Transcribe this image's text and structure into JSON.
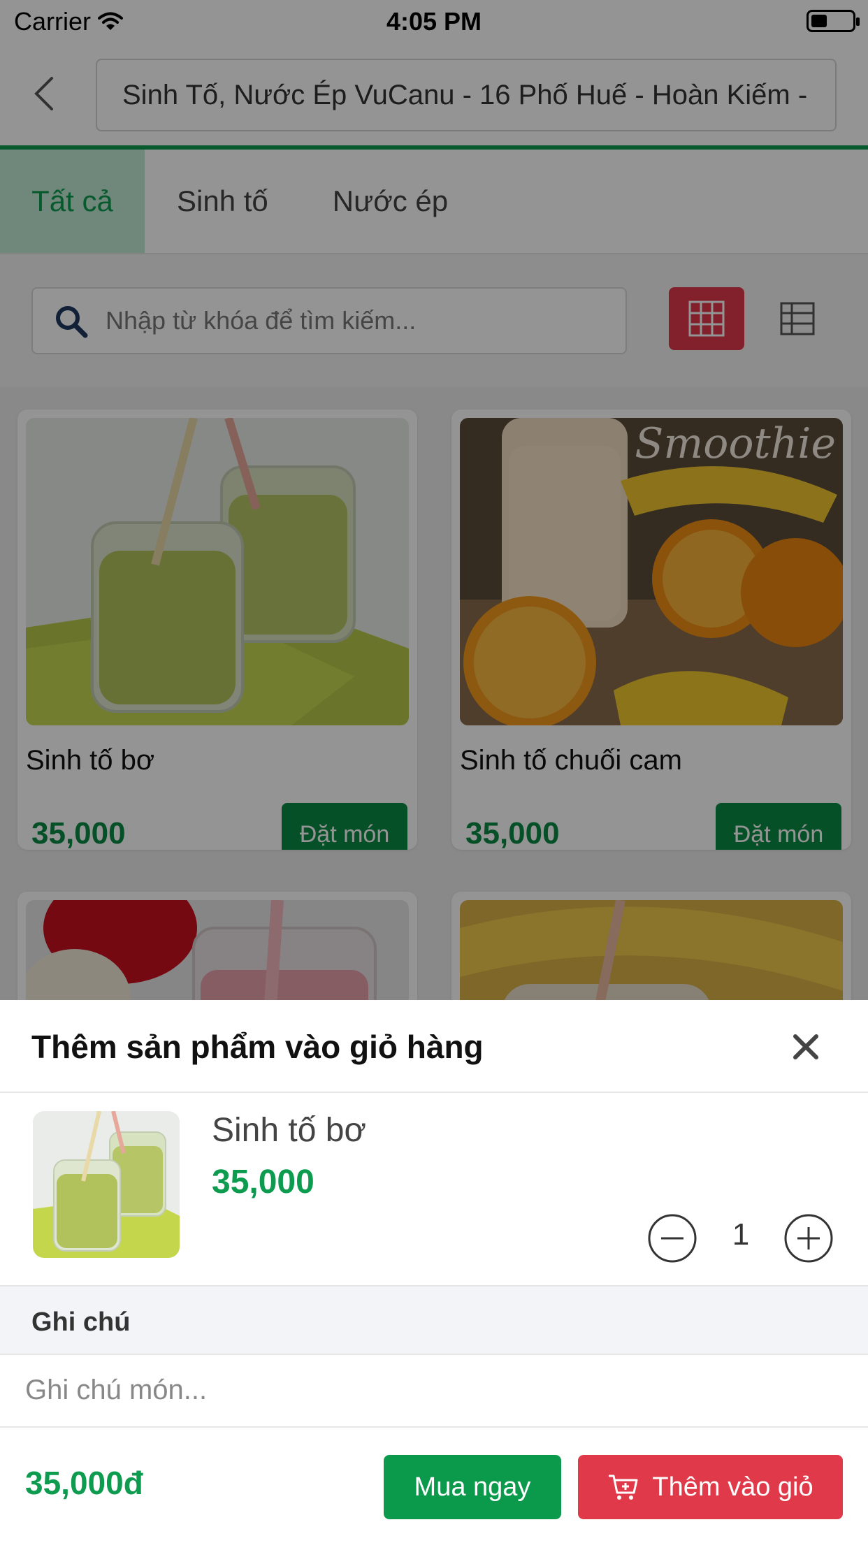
{
  "status_bar": {
    "carrier": "Carrier",
    "time": "4:05 PM"
  },
  "header": {
    "address": "Sinh Tố, Nước Ép VuCanu - 16 Phố Huế - Hoàn Kiếm -"
  },
  "tabs": [
    {
      "label": "Tất cả",
      "active": true
    },
    {
      "label": "Sinh tố",
      "active": false
    },
    {
      "label": "Nước ép",
      "active": false
    }
  ],
  "search": {
    "placeholder": "Nhập từ khóa để tìm kiếm...",
    "value": ""
  },
  "view_toggle": {
    "grid_icon": "grid-icon",
    "list_icon": "list-icon",
    "active": "grid"
  },
  "products": [
    {
      "name": "Sinh tố bơ",
      "price": "35,000",
      "button": "Đặt món"
    },
    {
      "name": "Sinh tố chuối cam",
      "price": "35,000",
      "button": "Đặt món",
      "image_text": "Smoothie"
    }
  ],
  "sheet": {
    "title": "Thêm sản phẩm vào giỏ hàng",
    "item": {
      "name": "Sinh tố bơ",
      "price": "35,000",
      "quantity": "1"
    },
    "note_label": "Ghi chú",
    "note_placeholder": "Ghi chú món...",
    "total": "35,000đ",
    "buy_now_label": "Mua ngay",
    "add_to_cart_label": "Thêm vào giỏ"
  },
  "colors": {
    "brand_green": "#0d9b4f",
    "accent_red": "#e03a4a"
  }
}
